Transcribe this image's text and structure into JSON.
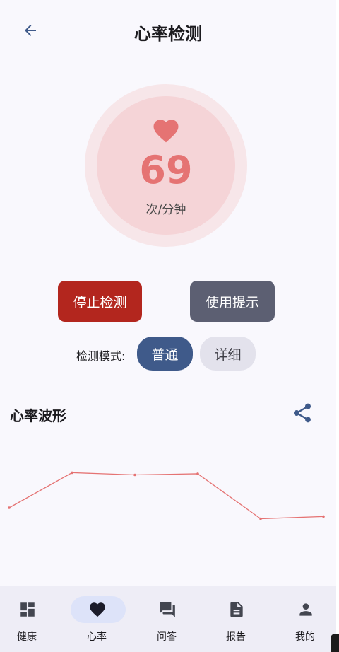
{
  "header": {
    "title": "心率检测",
    "back_icon": "arrow-back-icon"
  },
  "monitor": {
    "bpm": "69",
    "unit": "次/分钟",
    "icon": "heart-icon",
    "accent": "#e57373"
  },
  "actions": {
    "stop_label": "停止检测",
    "stop_color": "#b3261e",
    "tips_label": "使用提示",
    "tips_color": "#5c5f72"
  },
  "mode": {
    "label": "检测模式:",
    "options": [
      {
        "label": "普通",
        "selected": true
      },
      {
        "label": "详细",
        "selected": false
      }
    ],
    "selected_color": "#3f5a8a"
  },
  "waveform": {
    "title": "心率波形",
    "share_icon": "share-icon",
    "line_color": "#e57373",
    "values": [
      40,
      72,
      70,
      71,
      30,
      32
    ]
  },
  "nav": {
    "items": [
      {
        "label": "健康",
        "icon": "dashboard-icon",
        "active": false
      },
      {
        "label": "心率",
        "icon": "heart-icon",
        "active": true
      },
      {
        "label": "问答",
        "icon": "chat-icon",
        "active": false
      },
      {
        "label": "报告",
        "icon": "document-icon",
        "active": false
      },
      {
        "label": "我的",
        "icon": "person-icon",
        "active": false
      }
    ]
  }
}
